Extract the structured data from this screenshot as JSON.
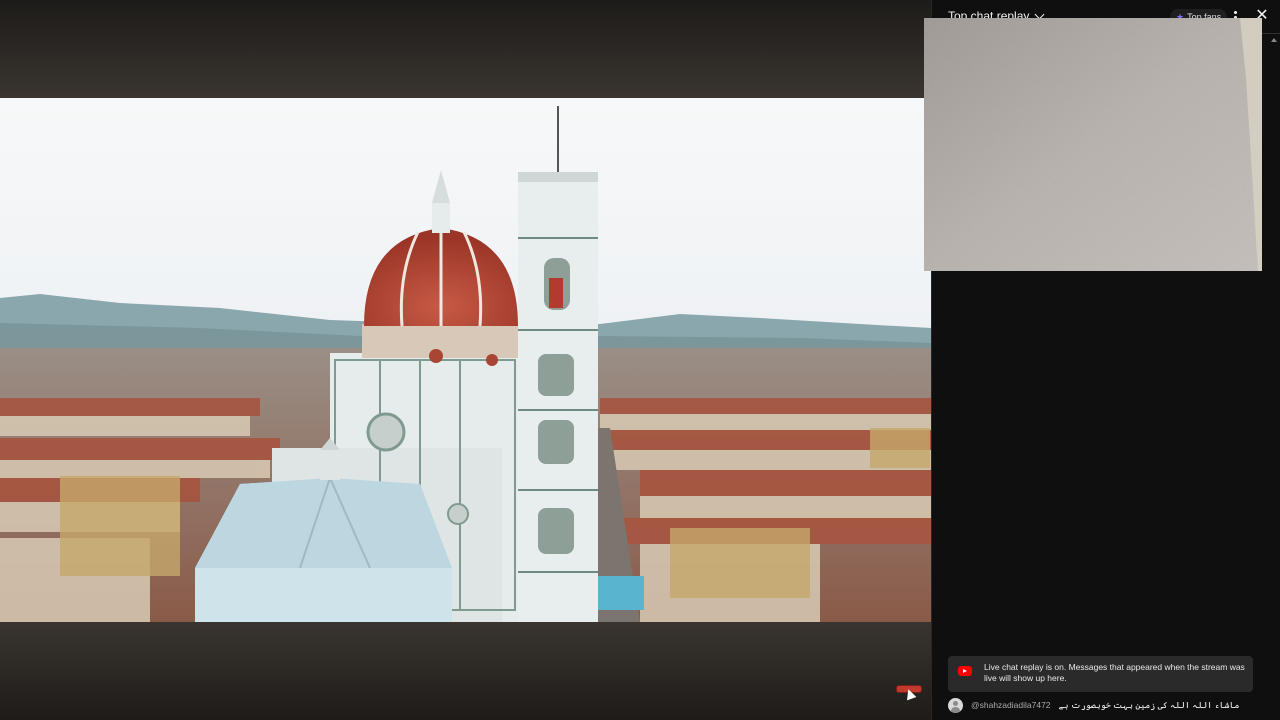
{
  "chat": {
    "title": "Top chat replay",
    "top_fans_label": "Top fans",
    "notice": "Live chat replay is on. Messages that appeared when the stream was live will show up here.",
    "messages": [
      {
        "author": "@shahzadiadila7472",
        "text": "ماشاء اللہ اللہ کی زمین بہت خوبصورت ہے"
      }
    ]
  },
  "icons": {
    "title_dropdown": "chevron-down-icon",
    "top_fans": "star-icon",
    "menu": "more-vert-icon",
    "close": "close-icon",
    "notice": "youtube-icon",
    "avatar": "user-avatar-icon"
  },
  "colors": {
    "background": "#0f0f0f",
    "notice_background": "#2a2a2a",
    "youtube_red": "#ff0000",
    "author": "#aaaaaa"
  }
}
